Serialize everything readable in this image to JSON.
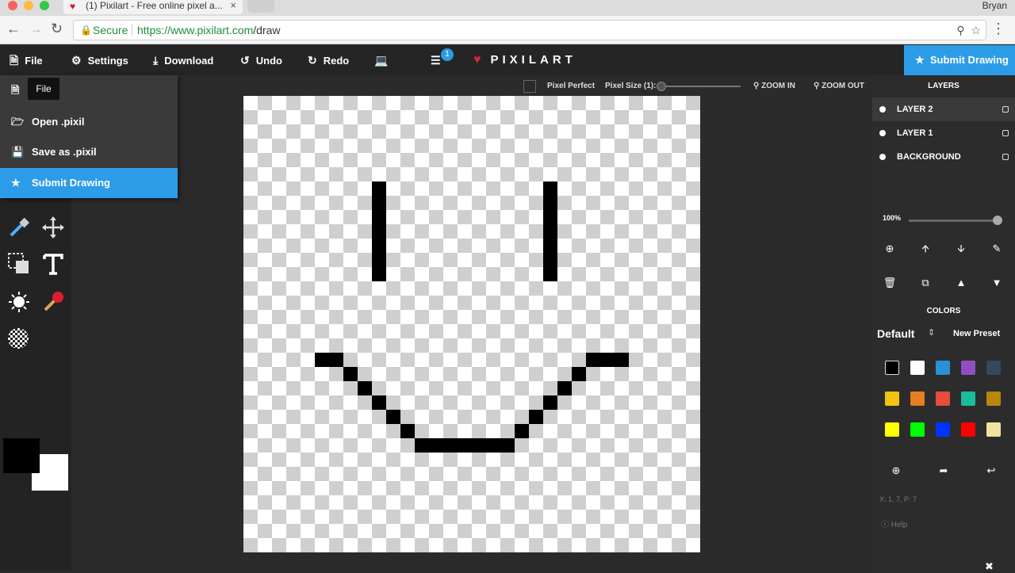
{
  "browser": {
    "tab_title": "(1) Pixilart - Free online pixel a...",
    "user": "Bryan",
    "secure_label": "Secure",
    "url_host": "https://www.pixilart.com",
    "url_path": "/draw",
    "traffic_colors": [
      "#fc605c",
      "#fdbc40",
      "#34c84a"
    ]
  },
  "toolbar": {
    "file": "File",
    "settings": "Settings",
    "download": "Download",
    "undo": "Undo",
    "redo": "Redo",
    "notif_count": "1",
    "logo": "PIXILART",
    "submit": "Submit Drawing"
  },
  "file_menu": {
    "tooltip": "File",
    "items": [
      {
        "label": "",
        "icon": "new-file-icon"
      },
      {
        "label": "Open .pixil",
        "icon": "folder-open-icon"
      },
      {
        "label": "Save as .pixil",
        "icon": "floppy-icon"
      },
      {
        "label": "Submit Drawing",
        "icon": "star-icon"
      }
    ]
  },
  "subbar": {
    "pixel_perfect": "Pixel Perfect",
    "pixel_size": "Pixel Size (1):",
    "zoom_in": "ZOOM IN",
    "zoom_out": "ZOOM OUT"
  },
  "layers": {
    "title": "LAYERS",
    "items": [
      "LAYER 2",
      "LAYER 1",
      "BACKGROUND"
    ],
    "opacity": "100%"
  },
  "colors": {
    "title": "COLORS",
    "preset": "Default",
    "new_preset": "New Preset",
    "primary": "#000000",
    "secondary": "#ffffff",
    "swatches": [
      "#000000",
      "#ffffff",
      "#2d8fd6",
      "#8f4fc2",
      "#34495e",
      "#f1c40f",
      "#e67e22",
      "#e74c3c",
      "#1abc9c",
      "#b8860b",
      "#ffff00",
      "#00ff00",
      "#0033ff",
      "#ff0000",
      "#f3e3a1"
    ]
  },
  "status": {
    "coords": "X: 1, 7, P: 7",
    "help": "Help"
  },
  "accent": "#2d9ce8"
}
